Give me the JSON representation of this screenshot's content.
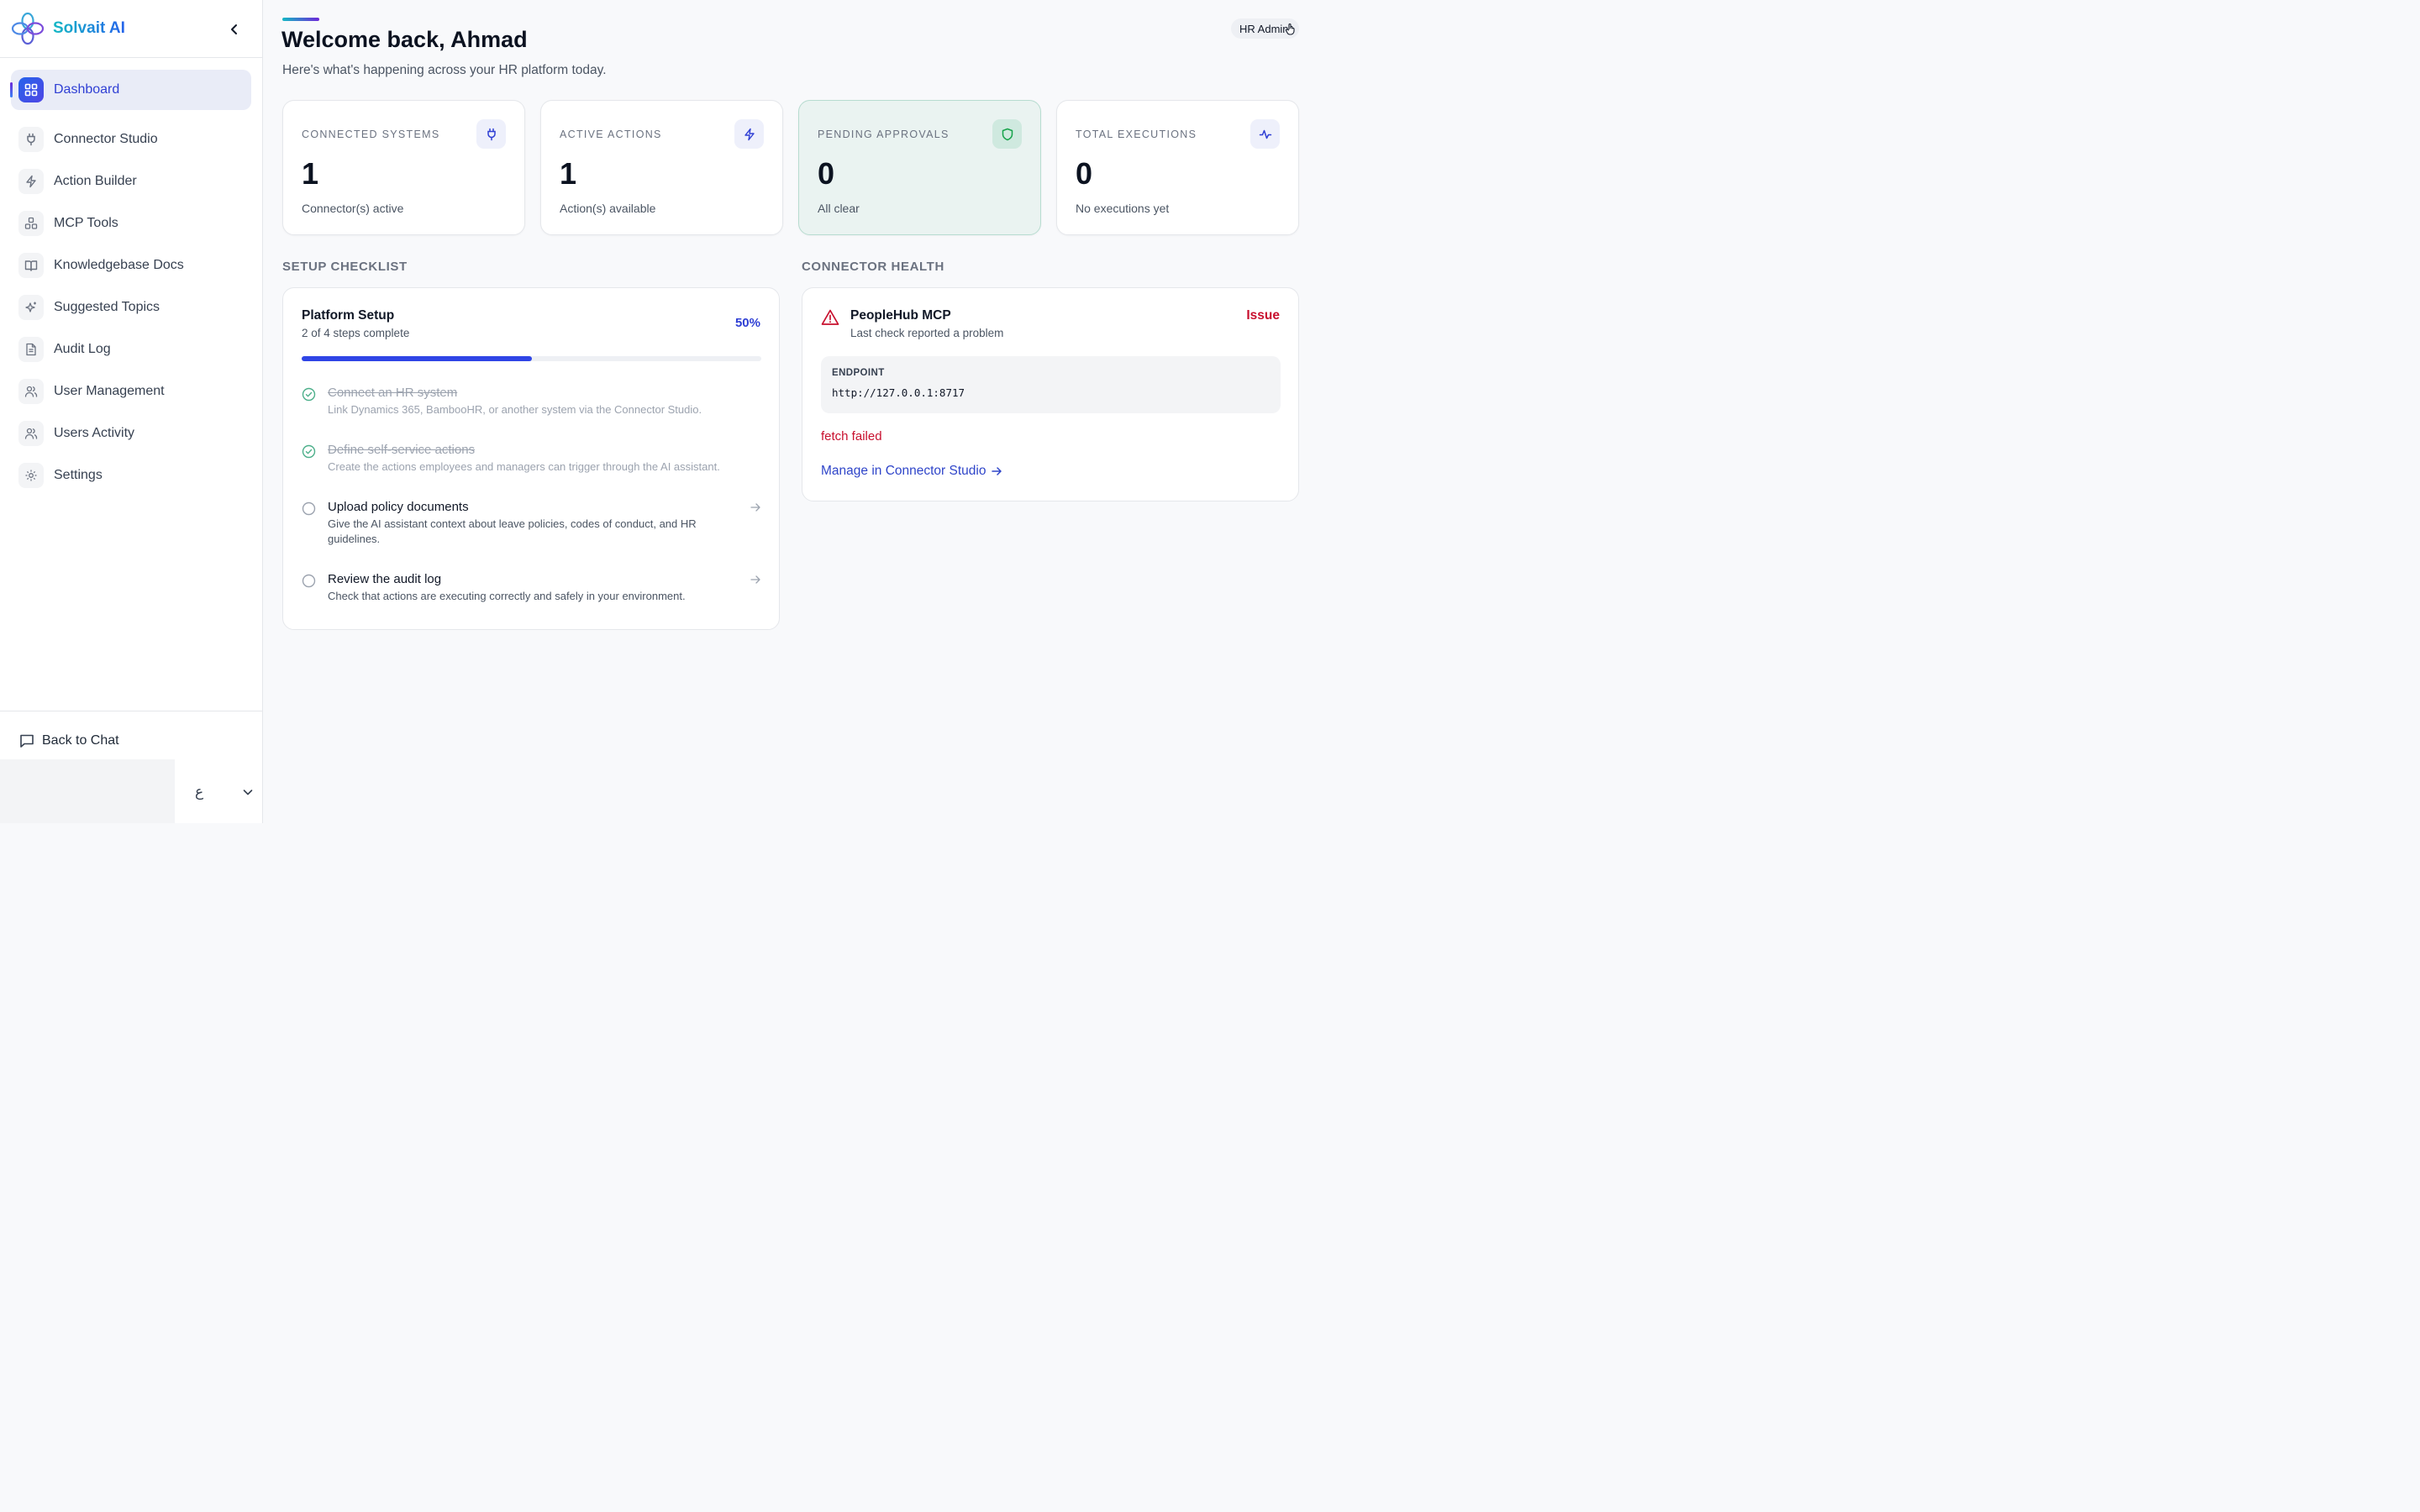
{
  "brand": {
    "name": "Solvait AI"
  },
  "sidebar": {
    "items": [
      {
        "label": "Dashboard",
        "icon": "grid-icon",
        "active": true
      },
      {
        "label": "Connector Studio",
        "icon": "plug-icon"
      },
      {
        "label": "Action Builder",
        "icon": "bolt-icon"
      },
      {
        "label": "MCP Tools",
        "icon": "boxes-icon"
      },
      {
        "label": "Knowledgebase Docs",
        "icon": "book-icon"
      },
      {
        "label": "Suggested Topics",
        "icon": "sparkles-icon"
      },
      {
        "label": "Audit Log",
        "icon": "file-text-icon"
      },
      {
        "label": "User Management",
        "icon": "users-icon"
      },
      {
        "label": "Users Activity",
        "icon": "users-icon"
      },
      {
        "label": "Settings",
        "icon": "gear-icon"
      }
    ],
    "back_to_chat": "Back to Chat",
    "language": "ع"
  },
  "header": {
    "title": "Welcome back, Ahmad",
    "subtitle": "Here's what's happening across your HR platform today.",
    "role_badge": "HR Admin"
  },
  "stats": [
    {
      "label": "CONNECTED SYSTEMS",
      "value": "1",
      "desc": "Connector(s) active",
      "icon": "plug-icon",
      "accent": "#2f3fd4"
    },
    {
      "label": "ACTIVE ACTIONS",
      "value": "1",
      "desc": "Action(s) available",
      "icon": "bolt-icon",
      "accent": "#2f3fd4"
    },
    {
      "label": "PENDING APPROVALS",
      "value": "0",
      "desc": "All clear",
      "icon": "shield-icon",
      "accent": "#16a34a"
    },
    {
      "label": "TOTAL EXECUTIONS",
      "value": "0",
      "desc": "No executions yet",
      "icon": "activity-icon",
      "accent": "#2f3fd4"
    }
  ],
  "setup": {
    "section_title": "SETUP CHECKLIST",
    "title": "Platform Setup",
    "subtitle": "2 of 4 steps complete",
    "percent_label": "50%",
    "progress": 0.5,
    "tasks": [
      {
        "title": "Connect an HR system",
        "desc": "Link Dynamics 365, BambooHR, or another system via the Connector Studio.",
        "done": true
      },
      {
        "title": "Define self-service actions",
        "desc": "Create the actions employees and managers can trigger through the AI assistant.",
        "done": true
      },
      {
        "title": "Upload policy documents",
        "desc": "Give the AI assistant context about leave policies, codes of conduct, and HR guidelines.",
        "done": false
      },
      {
        "title": "Review the audit log",
        "desc": "Check that actions are executing correctly and safely in your environment.",
        "done": false
      }
    ]
  },
  "health": {
    "section_title": "CONNECTOR HEALTH",
    "name": "PeopleHub MCP",
    "subtitle": "Last check reported a problem",
    "status": "Issue",
    "endpoint_label": "ENDPOINT",
    "endpoint": "http://127.0.0.1:8717",
    "error": "fetch failed",
    "link": "Manage in Connector Studio",
    "status_color": "#c8102e"
  }
}
